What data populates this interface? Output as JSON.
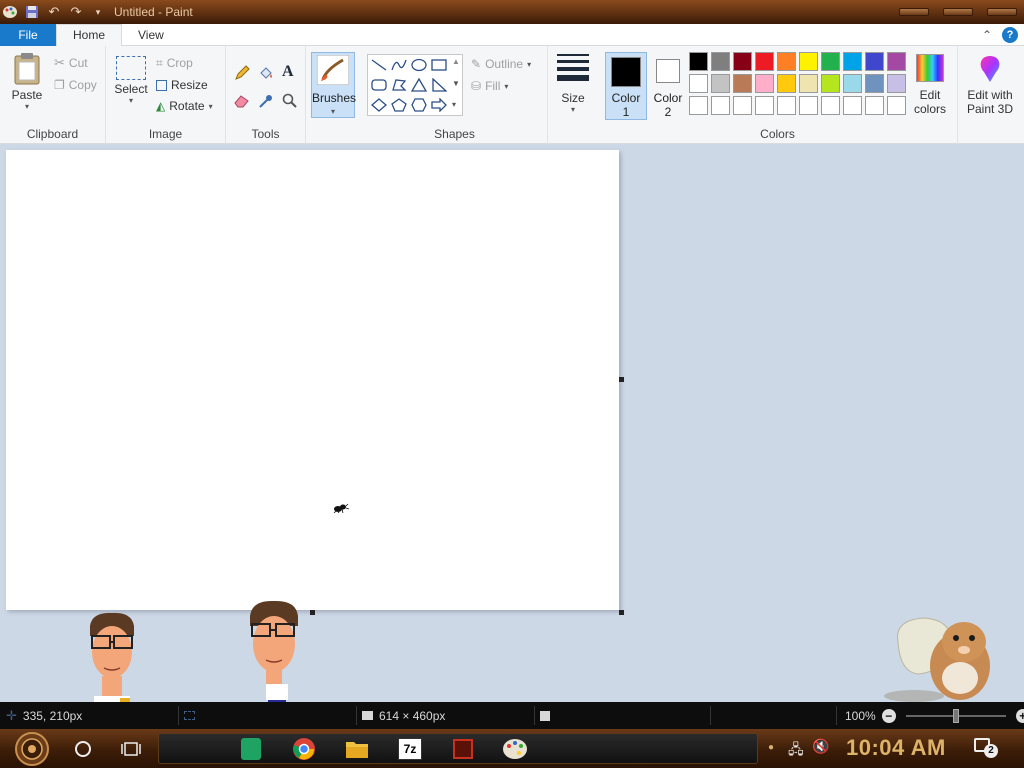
{
  "window": {
    "title": "Untitled - Paint"
  },
  "tabs": {
    "file": "File",
    "home": "Home",
    "view": "View",
    "help": "?"
  },
  "ribbon": {
    "clipboard": {
      "label": "Clipboard",
      "paste": "Paste",
      "cut": "Cut",
      "copy": "Copy"
    },
    "image": {
      "label": "Image",
      "select": "Select",
      "crop": "Crop",
      "resize": "Resize",
      "rotate": "Rotate"
    },
    "tools": {
      "label": "Tools"
    },
    "brushes": {
      "label": "Brushes"
    },
    "shapes": {
      "label": "Shapes",
      "outline": "Outline",
      "fill": "Fill"
    },
    "size": {
      "label": "Size"
    },
    "colors": {
      "label": "Colors",
      "color1": {
        "label": "Color",
        "num": "1",
        "value": "#000000"
      },
      "color2": {
        "label": "Color",
        "num": "2",
        "value": "#ffffff"
      },
      "edit_colors": "Edit colors",
      "edit_3d": "Edit with Paint 3D",
      "palette": [
        [
          "#000000",
          "#7f7f7f",
          "#880015",
          "#ed1c24",
          "#ff7f27",
          "#fff200",
          "#22b14c",
          "#00a2e8",
          "#3f48cc",
          "#a349a4"
        ],
        [
          "#ffffff",
          "#c3c3c3",
          "#b97a57",
          "#ffaec9",
          "#ffc90e",
          "#efe4b0",
          "#b5e61d",
          "#99d9ea",
          "#7092be",
          "#c8bfe7"
        ],
        [
          "#ffffff",
          "#ffffff",
          "#ffffff",
          "#ffffff",
          "#ffffff",
          "#ffffff",
          "#ffffff",
          "#ffffff",
          "#ffffff",
          "#ffffff"
        ]
      ]
    }
  },
  "status": {
    "cursor": "335, 210px",
    "canvas_size": "614 × 460px",
    "zoom": "100%"
  },
  "taskbar": {
    "clock": "10:04 AM",
    "notifications": "2"
  }
}
